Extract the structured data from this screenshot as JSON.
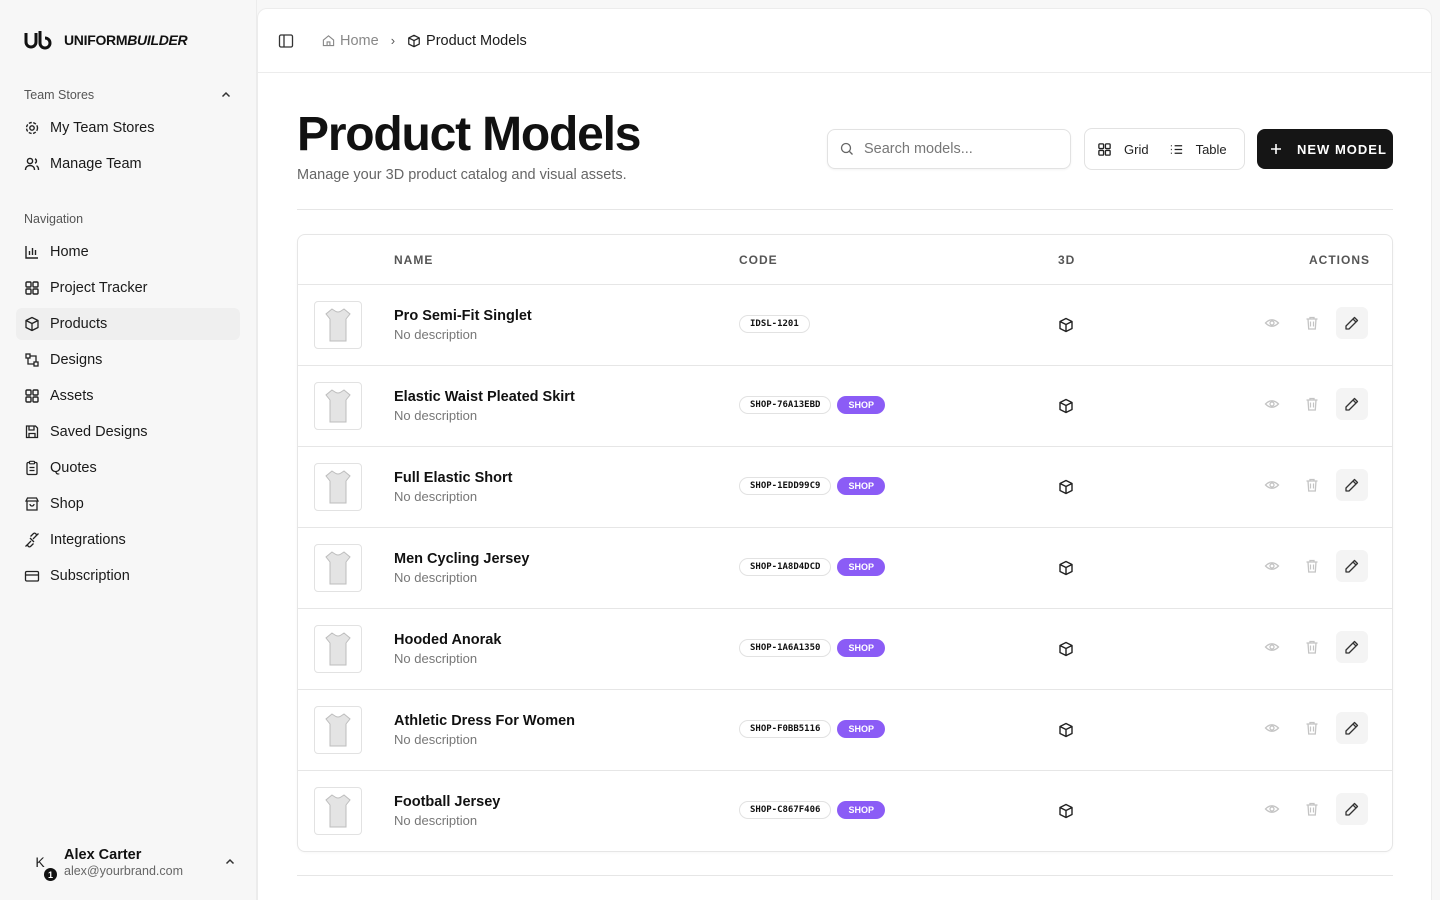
{
  "brand": {
    "name_a": "UNIFORM",
    "name_b": "BUILDER"
  },
  "sidebar": {
    "team_section": "Team Stores",
    "team_items": [
      {
        "label": "My Team Stores",
        "icon": "gear-icon"
      },
      {
        "label": "Manage Team",
        "icon": "users-icon"
      }
    ],
    "nav_section": "Navigation",
    "nav_items": [
      {
        "label": "Home",
        "icon": "bar-chart-icon"
      },
      {
        "label": "Project Tracker",
        "icon": "grid-icon"
      },
      {
        "label": "Products",
        "icon": "box-icon",
        "active": true
      },
      {
        "label": "Designs",
        "icon": "designs-icon"
      },
      {
        "label": "Assets",
        "icon": "grid-icon"
      },
      {
        "label": "Saved Designs",
        "icon": "save-icon"
      },
      {
        "label": "Quotes",
        "icon": "clipboard-icon"
      },
      {
        "label": "Shop",
        "icon": "store-icon"
      },
      {
        "label": "Integrations",
        "icon": "plug-icon"
      },
      {
        "label": "Subscription",
        "icon": "card-icon"
      }
    ]
  },
  "user": {
    "initial": "K",
    "badge": "1",
    "name": "Alex Carter",
    "email": "alex@yourbrand.com"
  },
  "breadcrumb": {
    "home": "Home",
    "current": "Product Models"
  },
  "header": {
    "title": "Product Models",
    "subtitle": "Manage your 3D product catalog and visual assets.",
    "search_placeholder": "Search models...",
    "grid_label": "Grid",
    "table_label": "Table",
    "new_label": "NEW MODEL"
  },
  "table": {
    "columns": {
      "name": "NAME",
      "code": "CODE",
      "three_d": "3D",
      "actions": "ACTIONS"
    },
    "rows": [
      {
        "name": "Pro Semi-Fit Singlet",
        "desc": "No description",
        "code": "IDSL-1201",
        "shop": ""
      },
      {
        "name": "Elastic Waist Pleated Skirt",
        "desc": "No description",
        "code": "SHOP-76A13EBD",
        "shop": "SHOP"
      },
      {
        "name": "Full Elastic Short",
        "desc": "No description",
        "code": "SHOP-1EDD99C9",
        "shop": "SHOP"
      },
      {
        "name": "Men Cycling Jersey",
        "desc": "No description",
        "code": "SHOP-1A8D4DCD",
        "shop": "SHOP"
      },
      {
        "name": "Hooded Anorak",
        "desc": "No description",
        "code": "SHOP-1A6A1350",
        "shop": "SHOP"
      },
      {
        "name": "Athletic Dress For Women",
        "desc": "No description",
        "code": "SHOP-F0BB5116",
        "shop": "SHOP"
      },
      {
        "name": "Football Jersey",
        "desc": "No description",
        "code": "SHOP-C867F406",
        "shop": "SHOP"
      }
    ]
  },
  "colors": {
    "accent": "#8b5cf6",
    "primary_button": "#151515"
  }
}
